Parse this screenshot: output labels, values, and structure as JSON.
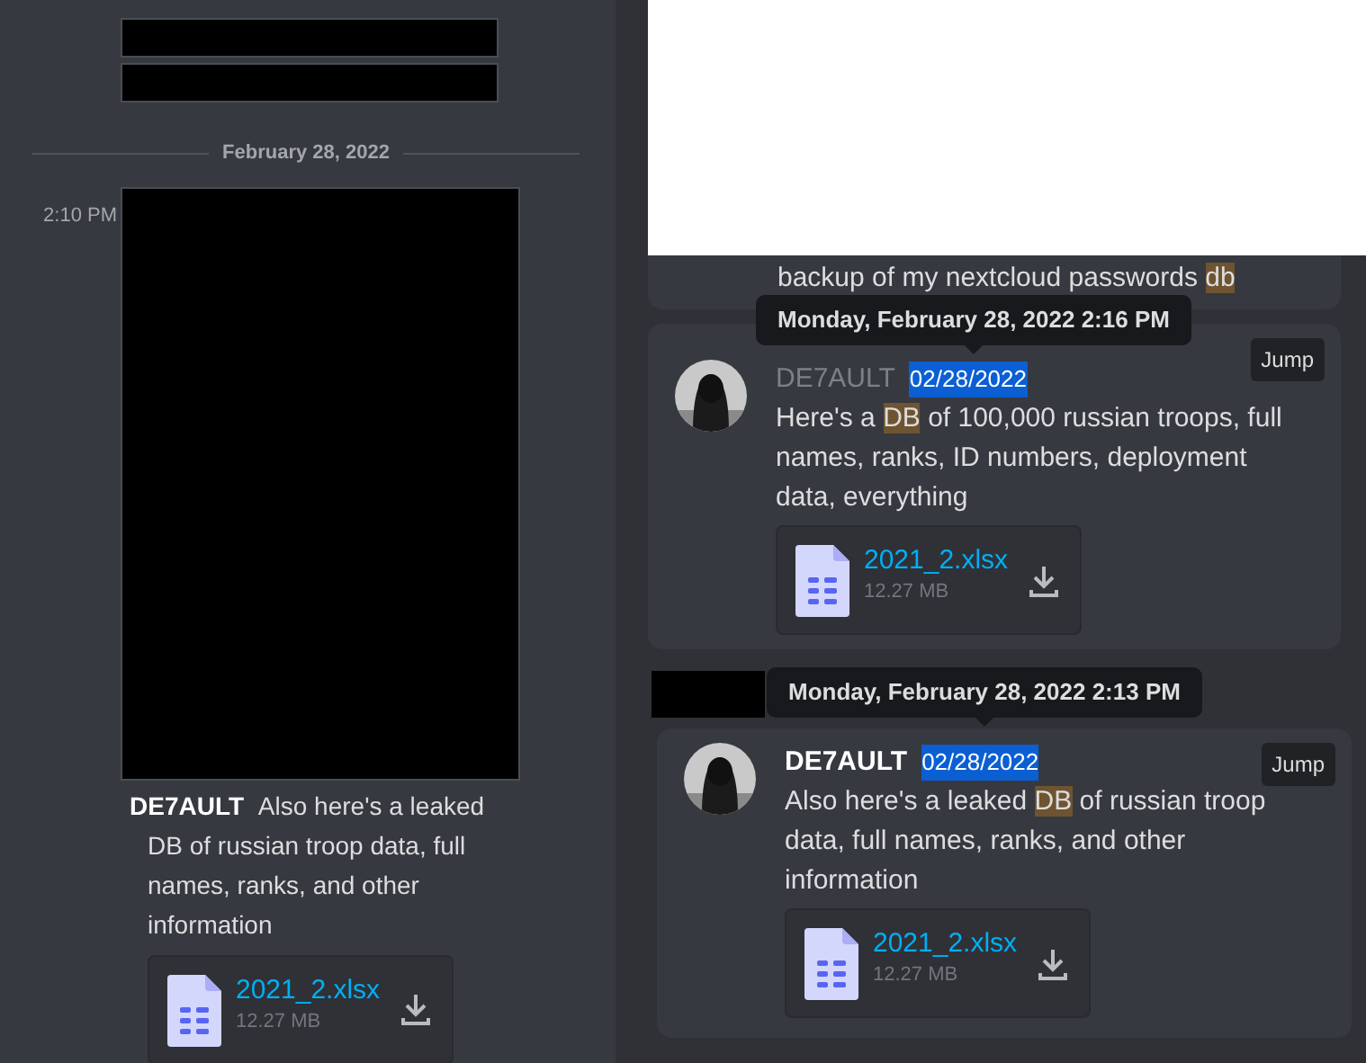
{
  "left_panel": {
    "date_divider": "February 28, 2022",
    "message": {
      "time": "2:10 PM",
      "author": "DE7AULT",
      "text": "Also here's a leaked DB of russian troop data, full names, ranks, and other information",
      "attachment": {
        "filename": "2021_2.xlsx",
        "size": "12.27 MB"
      }
    }
  },
  "search_results": [
    {
      "kind": "snippet",
      "segments": [
        {
          "text": "backup of my nextcloud passwords ",
          "highlighted": false
        },
        {
          "text": "db",
          "highlighted": true
        }
      ]
    },
    {
      "kind": "message",
      "tooltip": "Monday, February 28, 2022 2:16 PM",
      "author": "DE7AULT",
      "author_faded": true,
      "date": "02/28/2022",
      "date_selected": true,
      "jump": "Jump",
      "segments": [
        {
          "text": "Here's a ",
          "highlighted": false
        },
        {
          "text": "DB",
          "highlighted": true
        },
        {
          "text": " of 100,000 russian troops, full names, ranks, ID numbers, deployment data, everything",
          "highlighted": false
        }
      ],
      "attachment": {
        "filename": "2021_2.xlsx",
        "size": "12.27 MB"
      }
    },
    {
      "kind": "message",
      "tooltip": "Monday, February 28, 2022 2:13 PM",
      "author": "DE7AULT",
      "author_faded": false,
      "date": "02/28/2022",
      "date_selected": true,
      "jump": "Jump",
      "segments": [
        {
          "text": "Also here's a leaked ",
          "highlighted": false
        },
        {
          "text": "DB",
          "highlighted": true
        },
        {
          "text": " of russian troop data, full names, ranks, and other information",
          "highlighted": false
        }
      ],
      "attachment": {
        "filename": "2021_2.xlsx",
        "size": "12.27 MB"
      }
    }
  ]
}
